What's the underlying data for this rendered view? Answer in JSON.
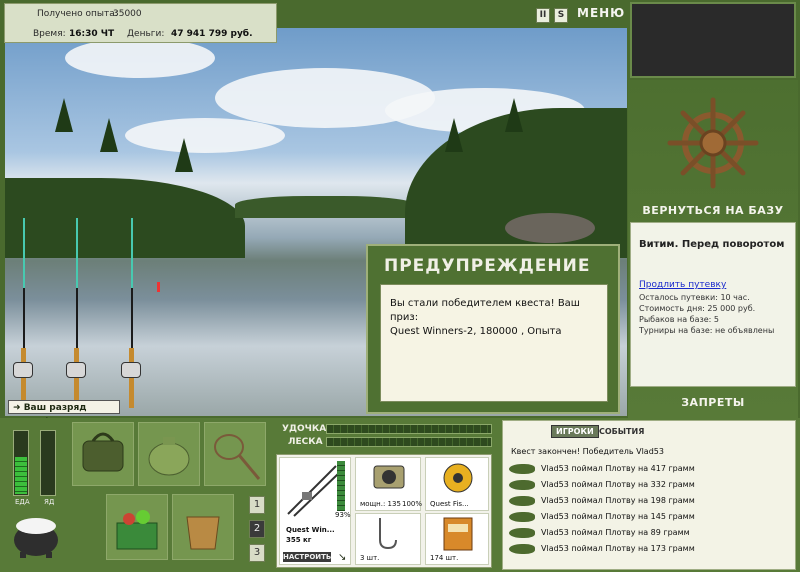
{
  "topbar": {
    "exp_label": "Получено опыта:",
    "exp_value": "35000",
    "time_label": "Время:",
    "time_value": "16:30 ЧТ",
    "money_label": "Деньги:",
    "money_value": "47 941 799 руб."
  },
  "top_controls": {
    "pause": "II",
    "sound": "S",
    "menu": "МЕНЮ"
  },
  "warning": {
    "title": "ПРЕДУПРЕЖДЕНИЕ",
    "message_line1": "Вы стали победителем квеста! Ваш приз:",
    "message_line2": "Quest Winners-2, 180000 , Опыта"
  },
  "level_up_text": "Ваш разряд вырос!",
  "right_panel": {
    "return_button": "ВЕРНУТЬСЯ НА БАЗУ",
    "location_name": "Витим. Перед поворотом",
    "extend_voucher": "Продлить путевку",
    "voucher_left": "Осталось путевки: 10 час.",
    "cost_per_day": "Стоимость дня: 25 000 руб.",
    "fishers_on_base": "Рыбаков на базе: 5",
    "tournaments": "Турниры на базе: не объявлены",
    "restrictions_button": "ЗАПРЕТЫ"
  },
  "status": {
    "food_label": "ЕДА",
    "poison_label": "ЯД",
    "food_level": 0.6,
    "poison_level": 0.0
  },
  "pages": [
    "1",
    "2",
    "3"
  ],
  "selected_page": "2",
  "tackle": {
    "rod_label": "УДОЧКА",
    "line_label": "ЛЕСКА",
    "rod_name": "Quest Win...",
    "rod_capacity": "355 кг",
    "rod_condition": "93%",
    "reel_power": "мощн.: 135",
    "reel_condition": "100%",
    "line_name": "Quest Fis...",
    "hooks_count": "3 шт.",
    "bait_count": "174 шт.",
    "configure_button": "НАСТРОИТЬ"
  },
  "log": {
    "tab_players": "ИГРОКИ",
    "tab_events": "СОБЫТИЯ",
    "header": "Квест закончен! Победитель Vlad53",
    "entries": [
      "Vlad53 поймал Плотву на 417 грамм",
      "Vlad53 поймал Плотву на 332 грамм",
      "Vlad53 поймал Плотву на 198 грамм",
      "Vlad53 поймал Плотву на 145 грамм",
      "Vlad53 поймал Плотву на 89 грамм",
      "Vlad53 поймал Плотву на 173 грамм"
    ]
  }
}
